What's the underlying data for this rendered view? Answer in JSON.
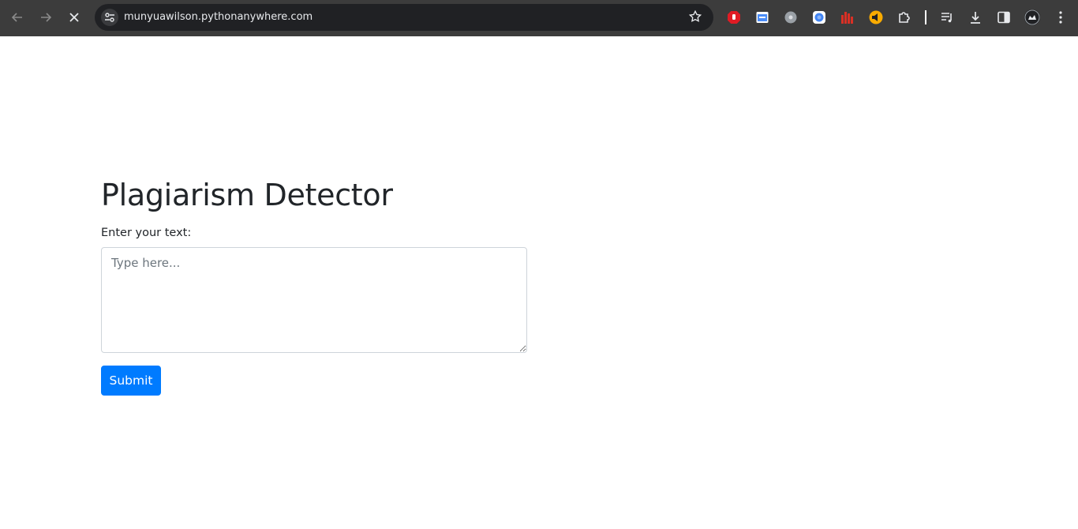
{
  "browser": {
    "url": "munyuawilson.pythonanywhere.com",
    "extensions": [
      {
        "name": "adblock-icon",
        "color": "#e01b24"
      },
      {
        "name": "window-ext-icon",
        "color": "#4a8cf7"
      },
      {
        "name": "gray-circle-ext-icon",
        "color": "#9aa0a6"
      },
      {
        "name": "chrome-ext-icon",
        "color": "#4285f4"
      },
      {
        "name": "equalizer-ext-icon",
        "color": "#d93025"
      },
      {
        "name": "volume-ext-icon",
        "color": "#f9ab00"
      }
    ]
  },
  "page": {
    "title": "Plagiarism Detector",
    "label": "Enter your text:",
    "textarea_placeholder": "Type here...",
    "submit_label": "Submit"
  },
  "colors": {
    "primary": "#007bff",
    "text": "#212529",
    "toolbar": "#3c3c3c"
  }
}
